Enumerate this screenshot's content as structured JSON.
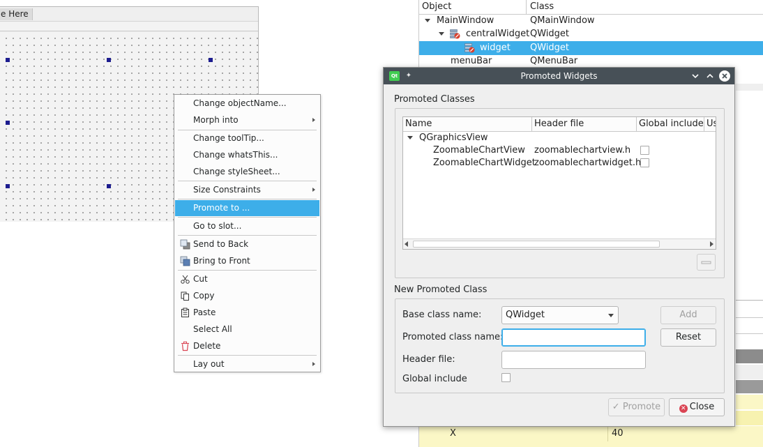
{
  "form_editor": {
    "menu_placeholder": "e Here"
  },
  "object_inspector": {
    "headers": {
      "object": "Object",
      "class": "Class"
    },
    "rows": [
      {
        "object": "MainWindow",
        "class": "QMainWindow"
      },
      {
        "object": "centralWidget",
        "class": "QWidget"
      },
      {
        "object": "widget",
        "class": "QWidget"
      },
      {
        "object": "menuBar",
        "class": "QMenuBar"
      }
    ],
    "partial_rows": [
      {
        "property": "X",
        "value": "40"
      }
    ]
  },
  "context_menu": {
    "items": [
      {
        "label": "Change objectName..."
      },
      {
        "label": "Morph into"
      },
      {
        "label": "Change toolTip..."
      },
      {
        "label": "Change whatsThis..."
      },
      {
        "label": "Change styleSheet..."
      },
      {
        "label": "Size Constraints"
      },
      {
        "label": "Promote to ..."
      },
      {
        "label": "Go to slot..."
      },
      {
        "label": "Send to Back"
      },
      {
        "label": "Bring to Front"
      },
      {
        "label": "Cut"
      },
      {
        "label": "Copy"
      },
      {
        "label": "Paste"
      },
      {
        "label": "Select All"
      },
      {
        "label": "Delete"
      },
      {
        "label": "Lay out"
      }
    ]
  },
  "dialog": {
    "title": "Promoted Widgets",
    "promoted_classes": {
      "group_title": "Promoted Classes",
      "columns": [
        "Name",
        "Header file",
        "Global include",
        "Us"
      ],
      "base_class": "QGraphicsView",
      "rows": [
        {
          "name": "ZoomableChartView",
          "header": "zoomablechartview.h",
          "global": false
        },
        {
          "name": "ZoomableChartWidget",
          "header": "zoomablechartwidget.h",
          "global": false
        }
      ]
    },
    "new_class": {
      "group_title": "New Promoted Class",
      "base_label": "Base class name:",
      "base_value": "QWidget",
      "promoted_label": "Promoted class name:",
      "promoted_value": "",
      "header_label": "Header file:",
      "header_value": "",
      "global_label": "Global include",
      "add_label": "Add",
      "reset_label": "Reset"
    },
    "promote_label": "Promote",
    "close_label": "Close"
  },
  "colors": {
    "selection": "#3daee9",
    "titlebar": "#475057",
    "accent_close": "#da4453",
    "handle": "#1d1d8f",
    "property_highlight": "#fbf7c6"
  }
}
